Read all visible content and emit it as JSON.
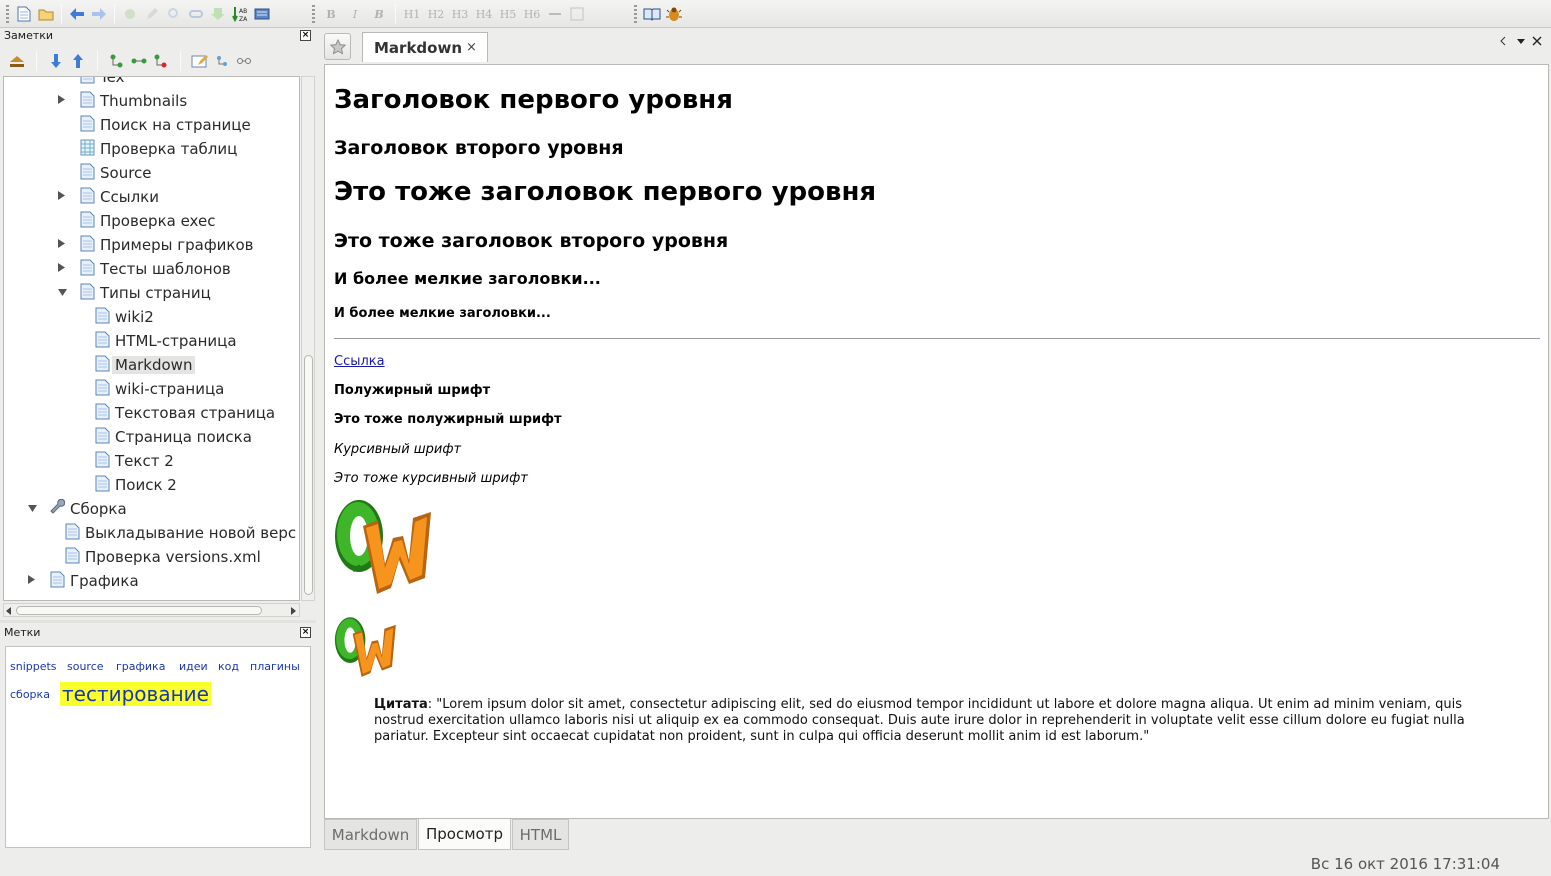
{
  "toolbar": {
    "format_buttons": [
      "B",
      "I",
      "B",
      "H1",
      "H2",
      "H3",
      "H4",
      "H5",
      "H6"
    ]
  },
  "notes_panel": {
    "title": "Заметки",
    "tree": [
      {
        "label": "Tex",
        "depth": 2,
        "arrow": "none",
        "icon": "page-icon"
      },
      {
        "label": "Thumbnails",
        "depth": 2,
        "arrow": "collapsed",
        "icon": "page-icon"
      },
      {
        "label": "Поиск на странице",
        "depth": 2,
        "arrow": "none",
        "icon": "page-icon"
      },
      {
        "label": "Проверка таблиц",
        "depth": 2,
        "arrow": "none",
        "icon": "table-page-icon"
      },
      {
        "label": "Source",
        "depth": 2,
        "arrow": "none",
        "icon": "page-icon"
      },
      {
        "label": "Ссылки",
        "depth": 2,
        "arrow": "collapsed",
        "icon": "page-icon"
      },
      {
        "label": "Проверка exec",
        "depth": 2,
        "arrow": "none",
        "icon": "page-icon"
      },
      {
        "label": "Примеры графиков",
        "depth": 2,
        "arrow": "collapsed",
        "icon": "page-icon"
      },
      {
        "label": "Тесты шаблонов",
        "depth": 2,
        "arrow": "collapsed",
        "icon": "page-icon"
      },
      {
        "label": "Типы страниц",
        "depth": 2,
        "arrow": "expanded",
        "icon": "page-icon"
      },
      {
        "label": "wiki2",
        "depth": 3,
        "arrow": "none",
        "icon": "page-icon"
      },
      {
        "label": "HTML-страница",
        "depth": 3,
        "arrow": "none",
        "icon": "page-icon"
      },
      {
        "label": "Markdown",
        "depth": 3,
        "arrow": "none",
        "icon": "page-icon",
        "selected": true
      },
      {
        "label": "wiki-страница",
        "depth": 3,
        "arrow": "none",
        "icon": "page-icon"
      },
      {
        "label": "Текстовая страница",
        "depth": 3,
        "arrow": "none",
        "icon": "page-icon"
      },
      {
        "label": "Страница поиска",
        "depth": 3,
        "arrow": "none",
        "icon": "page-icon"
      },
      {
        "label": "Текст 2",
        "depth": 3,
        "arrow": "none",
        "icon": "page-icon"
      },
      {
        "label": "Поиск 2",
        "depth": 3,
        "arrow": "none",
        "icon": "page-icon"
      },
      {
        "label": "Сборка",
        "depth": 0,
        "arrow": "expanded",
        "icon": "wrench-icon"
      },
      {
        "label": "Выкладывание новой верс",
        "depth": 1,
        "arrow": "none",
        "icon": "page-icon"
      },
      {
        "label": "Проверка versions.xml",
        "depth": 1,
        "arrow": "none",
        "icon": "page-icon"
      },
      {
        "label": "Графика",
        "depth": 0,
        "arrow": "collapsed",
        "icon": "page-icon"
      }
    ]
  },
  "tags_panel": {
    "title": "Метки",
    "tags": [
      {
        "label": "snippets"
      },
      {
        "label": "source"
      },
      {
        "label": "графика"
      },
      {
        "label": "идеи"
      },
      {
        "label": "код"
      },
      {
        "label": "плагины"
      },
      {
        "label": "сборка"
      },
      {
        "label": "тестирование",
        "highlighted": true
      }
    ]
  },
  "editor": {
    "tab_title": "Markdown",
    "tab_close": "×",
    "content": {
      "h1_a": "Заголовок первого уровня",
      "h2_a": "Заголовок второго уровня",
      "h1_b": "Это тоже заголовок первого уровня",
      "h2_b": "Это тоже заголовок второго уровня",
      "h3": "И более мелкие заголовки...",
      "h4": "И более мелкие заголовки...",
      "link": "Ссылка",
      "bold_a": "Полужирный шрифт",
      "bold_b": "Это тоже полужирный шрифт",
      "italic_a": "Курсивный шрифт",
      "italic_b": "Это тоже курсивный шрифт",
      "quote_label": "Цитата",
      "quote_text": ": \"Lorem ipsum dolor sit amet, consectetur adipiscing elit, sed do eiusmod tempor incididunt ut labore et dolore magna aliqua. Ut enim ad minim veniam, quis nostrud exercitation ullamco laboris nisi ut aliquip ex ea commodo consequat. Duis aute irure dolor in reprehenderit in voluptate velit esse cillum dolore eu fugiat nulla pariatur. Excepteur sint occaecat cupidatat non proident, sunt in culpa qui officia deserunt mollit anim id est laborum.\""
    },
    "view_tabs": [
      {
        "label": "Markdown",
        "active": false
      },
      {
        "label": "Просмотр",
        "active": true
      },
      {
        "label": "HTML",
        "active": false
      }
    ]
  },
  "status": {
    "datetime": "Вс 16 окт 2016 17:31:04"
  },
  "colors": {
    "link": "#1a1aa8",
    "tag": "#1a37b0",
    "tag_highlight": "#fbff2c",
    "logo_green": "#2d9e1e",
    "logo_orange": "#f7941d"
  }
}
